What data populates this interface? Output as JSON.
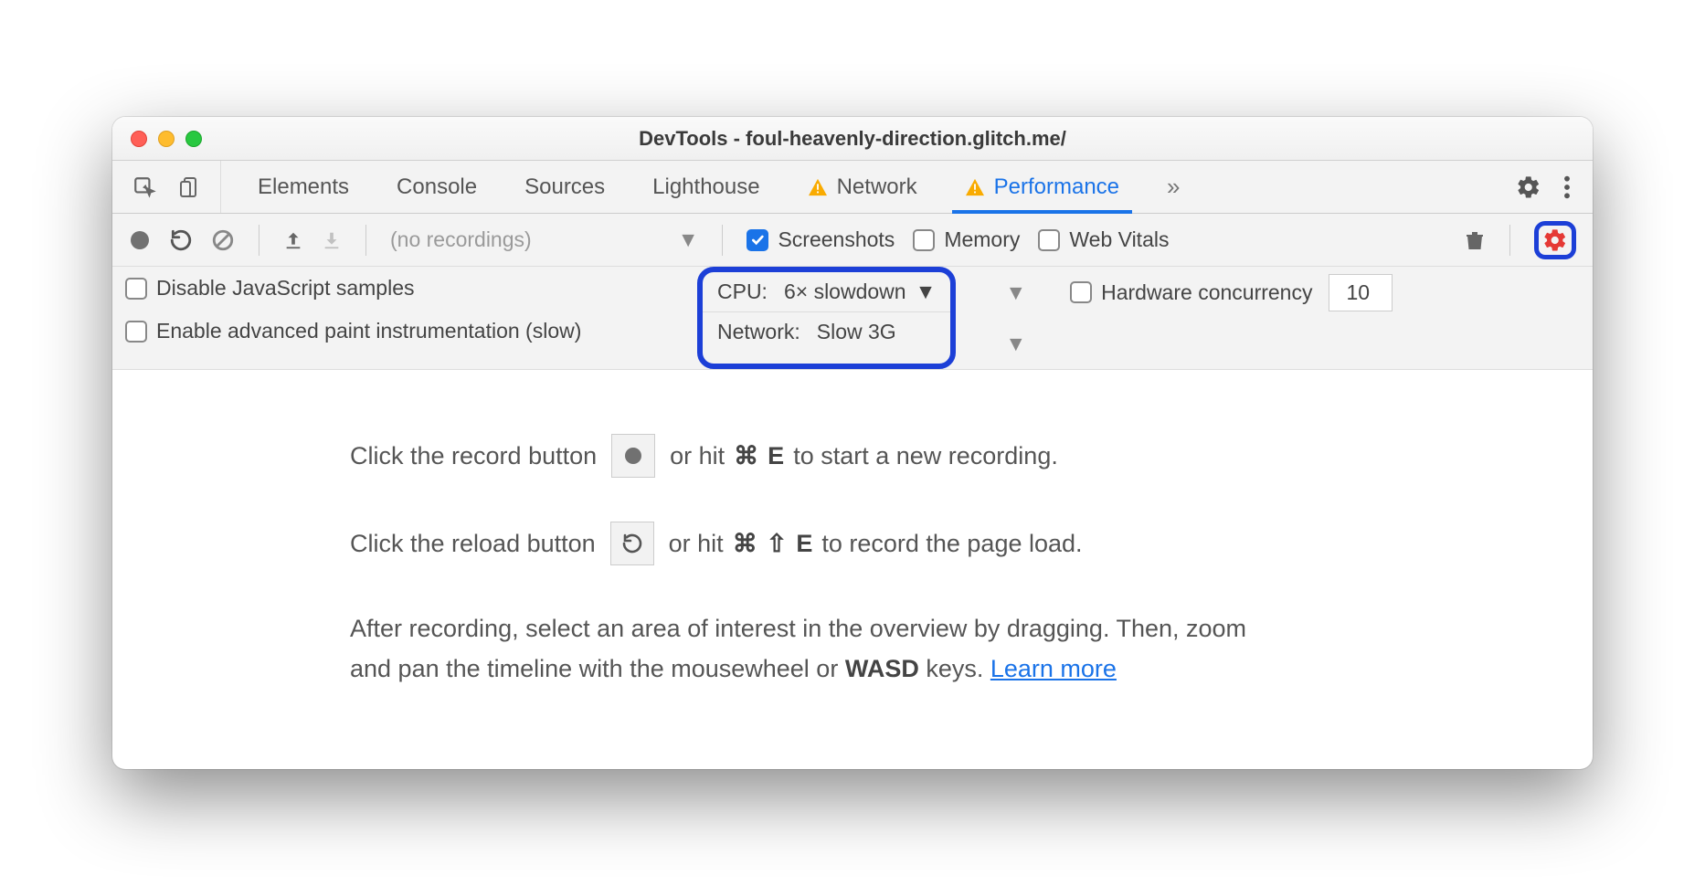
{
  "window": {
    "title": "DevTools - foul-heavenly-direction.glitch.me/"
  },
  "tabs": {
    "items": [
      "Elements",
      "Console",
      "Sources",
      "Lighthouse",
      "Network",
      "Performance"
    ],
    "more": "»"
  },
  "toolbar": {
    "recordings_placeholder": "(no recordings)",
    "screenshots": "Screenshots",
    "memory": "Memory",
    "webvitals": "Web Vitals"
  },
  "settings": {
    "disable_js": "Disable JavaScript samples",
    "cpu_label": "CPU:",
    "cpu_value": "6× slowdown",
    "hw_label": "Hardware concurrency",
    "hw_value": "10",
    "paint_line": "Enable advanced paint instrumentation (slow)",
    "net_label": "Network:",
    "net_value": "Slow 3G"
  },
  "content": {
    "line1a": "Click the record button",
    "line1b": "or hit",
    "k1": "⌘",
    "k2": "E",
    "line1c": "to start a new recording.",
    "line2a": "Click the reload button",
    "line2b": "or hit",
    "k3": "⌘",
    "k4": "⇧",
    "k5": "E",
    "line2c": "to record the page load.",
    "line3a": "After recording, select an area of interest in the overview by dragging. Then, zoom and pan the timeline with the mousewheel or ",
    "wasd": "WASD",
    "line3b": " keys. ",
    "learn": "Learn more"
  }
}
